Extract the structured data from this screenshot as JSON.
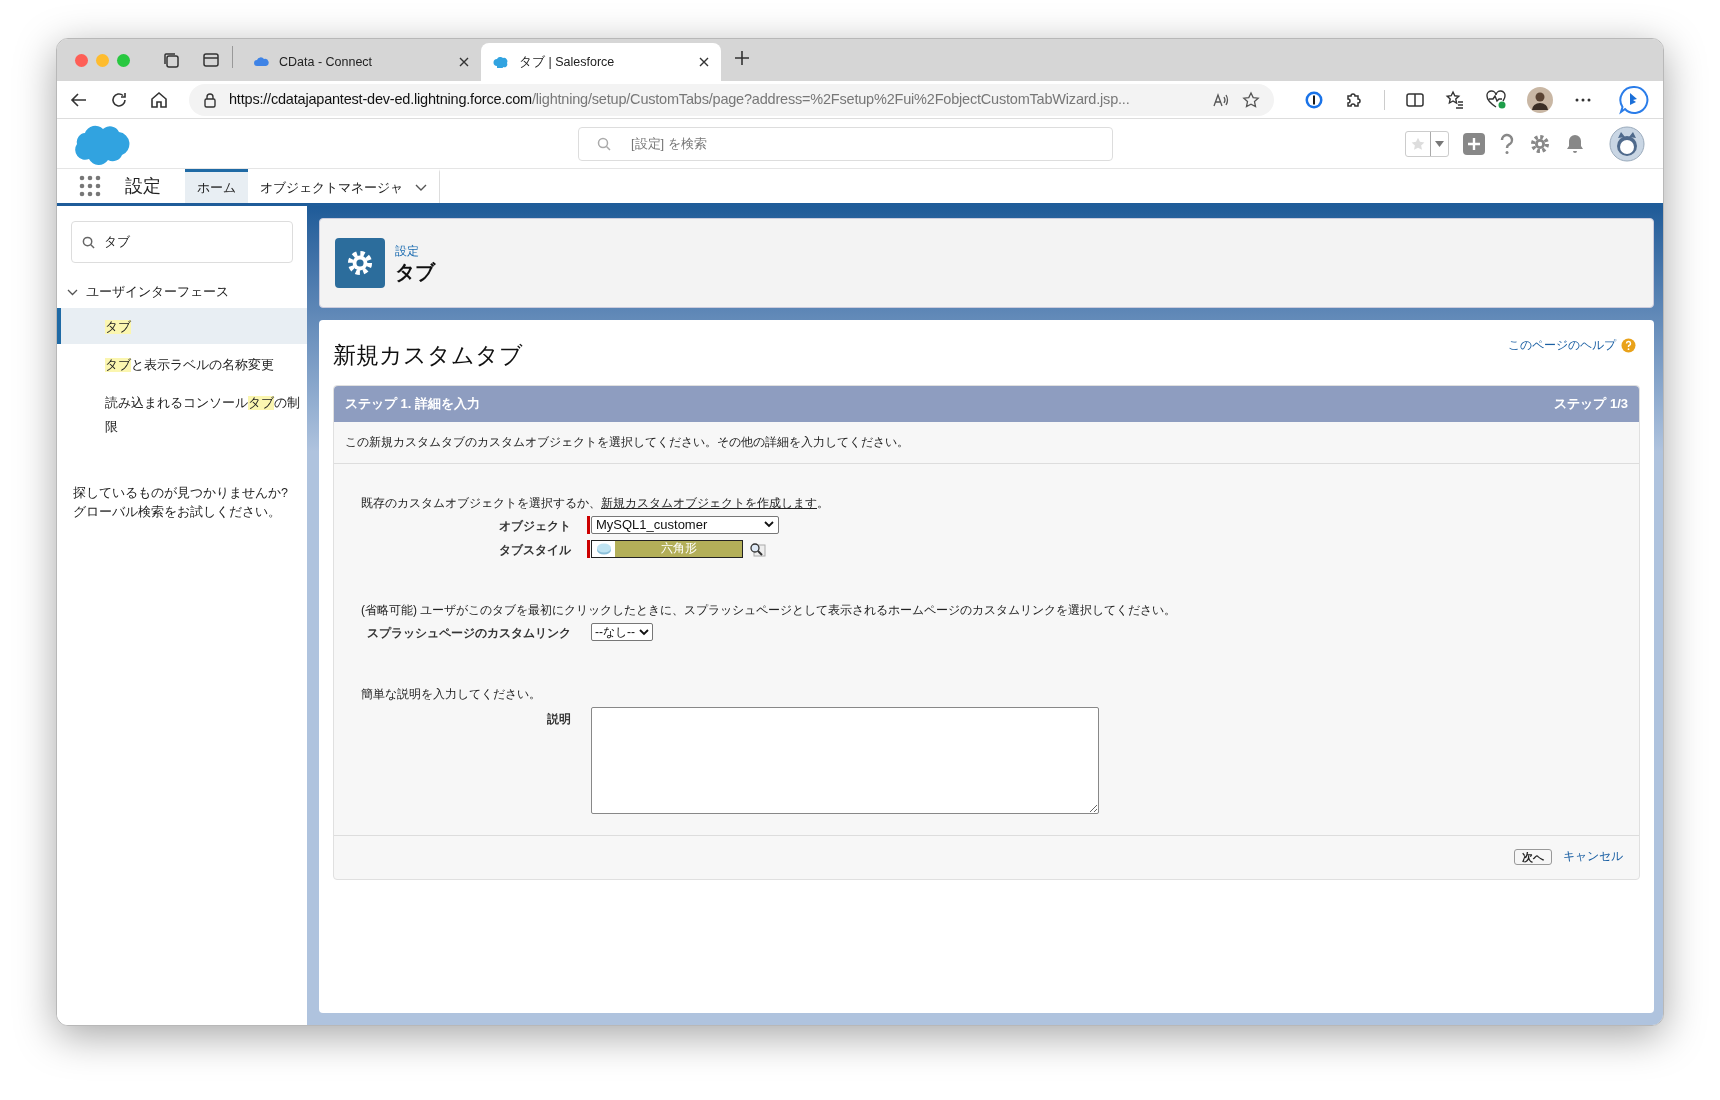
{
  "browser": {
    "tabs": [
      {
        "title": "CData - Connect",
        "selected": false
      },
      {
        "title": "タブ | Salesforce",
        "selected": true
      }
    ],
    "url": {
      "host": "https://cdatajapantest-dev-ed.lightning.force.com",
      "path": "/lightning/setup/CustomTabs/page?address=%2Fsetup%2Fui%2FobjectCustomTabWizard.jsp..."
    }
  },
  "header": {
    "search": {
      "placeholder": "[設定] を検索"
    }
  },
  "nav": {
    "app_name": "設定",
    "tabs": [
      {
        "label": "ホーム",
        "selected": true,
        "menu": false
      },
      {
        "label": "オブジェクトマネージャ",
        "selected": false,
        "menu": true
      }
    ]
  },
  "sidebar": {
    "search": {
      "value": "タブ"
    },
    "group": {
      "label": "ユーザインターフェース",
      "expanded": true,
      "children": [
        {
          "segments": [
            {
              "text": "タブ",
              "highlight": true
            }
          ],
          "selected": true
        },
        {
          "segments": [
            {
              "text": "タブ",
              "highlight": true
            },
            {
              "text": "と表示ラベルの名称変更",
              "highlight": false
            }
          ],
          "selected": false
        },
        {
          "segments": [
            {
              "text": "読み込まれるコンソール",
              "highlight": false
            },
            {
              "text": "タブ",
              "highlight": true
            },
            {
              "text": "の制限",
              "highlight": false
            }
          ],
          "selected": false
        }
      ]
    },
    "hint": "探しているものが見つかりませんか?\nグローバル検索をお試しください。"
  },
  "page_header": {
    "breadcrumb": "設定",
    "title": "タブ"
  },
  "card": {
    "title": "新規カスタムタブ",
    "help_link": "このページのヘルプ",
    "step": {
      "title": "ステップ 1. 詳細を入力",
      "counter": "ステップ 1/3"
    },
    "intro": "この新規カスタムタブのカスタムオブジェクトを選択してください。その他の詳細を入力してください。",
    "sections": [
      {
        "text": "既存のカスタムオブジェクトを選択するか、",
        "link": "新規カスタムオブジェクトを作成します",
        "text_after": "。",
        "fields": [
          {
            "label": "オブジェクト",
            "kind": "select",
            "value": "MySQL1_customer",
            "required": true
          },
          {
            "label": "タブスタイル",
            "kind": "style",
            "value": "六角形",
            "color": "#b3af59",
            "required": true
          }
        ]
      },
      {
        "text": "(省略可能) ユーザがこのタブを最初にクリックしたときに、スプラッシュページとして表示されるホームページのカスタムリンクを選択してください。",
        "fields": [
          {
            "label": "スプラッシュページのカスタムリンク",
            "kind": "select",
            "value": "--なし--",
            "required": false
          }
        ]
      },
      {
        "text": "簡単な説明を入力してください。",
        "fields": [
          {
            "label": "説明",
            "kind": "textarea",
            "required": false
          }
        ]
      }
    ],
    "buttons": {
      "next": "次へ",
      "cancel": "キャンセル"
    }
  }
}
